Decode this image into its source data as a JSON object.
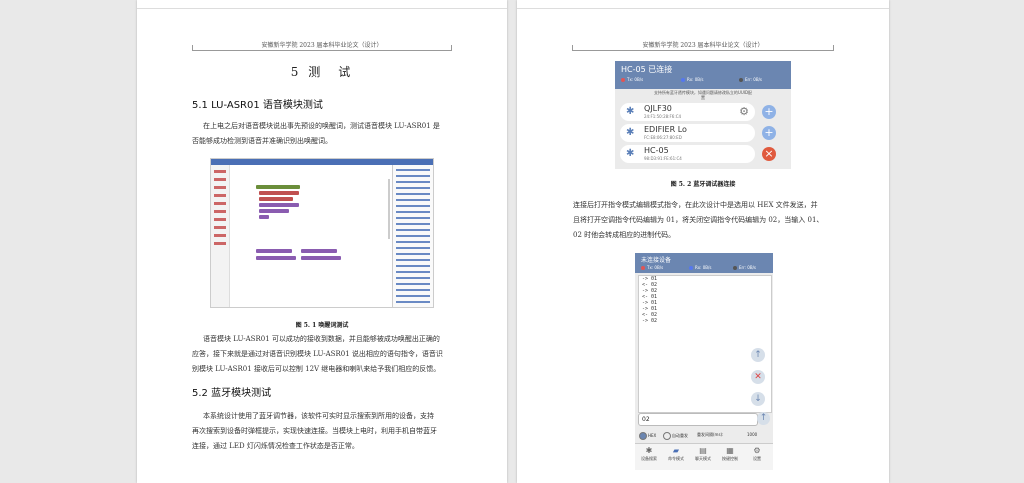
{
  "header_text": "安徽新华学院 2023 届本科毕业论文（设计）",
  "left": {
    "chapter_title": "5 测　试",
    "sec1_title": "5.1 LU-ASR01 语音模块测试",
    "para1_line1": "在上电之后对语音模块说出事先预设的唤醒词，测试语音模块 LU-ASR01 是",
    "para1_line2": "否能够成功检测到语音并准确识别出唤醒词。",
    "fig1_caption": "图 5. 1 唤醒词测试",
    "para2_line1": "语音模块 LU-ASR01 可以成功的接收到数据，并且能够被成功唤醒出正确的",
    "para2_line2": "应答，接下来就是通过对语音识别模块 LU-ASR01 说出相应的语句指令，语音识",
    "para2_line3": "别模块 LU-ASR01 接收后可以控制 12V 继电器和喇叭来给予我们相应的反馈。",
    "sec2_title": "5.2 蓝牙模块测试",
    "para3_line1": "本系统设计使用了蓝牙调节器，该软件可实时显示搜索到所用的设备，支持",
    "para3_line2": "再次搜索到设备时弹框提示，实现快速连接。当模块上电时，利用手机自带蓝牙",
    "para3_line3": "连接，通过 LED 灯闪烁情况检查工作状态是否正常。"
  },
  "right": {
    "phone1": {
      "title": "HC-05 已连接",
      "tx": "Tx: 0B/s",
      "rx": "Rx: 0B/s",
      "err": "Err: 0B/s",
      "hint_line1": "支持所有蓝牙透传模块，如遇问题请修改私立的UUID配",
      "hint_line2": "置",
      "devices": [
        {
          "name": "QJLF30",
          "mac": "24:F1:50:28:F6:C4"
        },
        {
          "name": "EDIFIER Lo",
          "mac": "FC:E8:06:27:80:ED"
        },
        {
          "name": "HC-05",
          "mac": "98:D3:91:FE:61:C4"
        }
      ]
    },
    "fig2_caption": "图 5. 2 蓝牙调试器连接",
    "para1_line1": "连接后打开指令模式编辑模式指令，在此次设计中是选用以 HEX 文件发送，并",
    "para1_line2": "且将打开空调指令代码编辑为 01，将关闭空调指令代码编辑为 02，当输入 01、",
    "para1_line3": "02 时他会转成相应的进制代码。",
    "phone2": {
      "title": "未连接设备",
      "tx": "Tx: 0B/s",
      "rx": "Rx: 0B/s",
      "err": "Err: 0B/s",
      "log": [
        "-> 01",
        "<- 02",
        "-> 02",
        "<- 01",
        "-> 01",
        "-> 01",
        "<- 02",
        "-> 02"
      ],
      "input_value": "02",
      "opt_hex": "HEX",
      "opt_auto": "自动重发",
      "opt_interval": "重发间隔(ms):",
      "opt_interval_value": "1000",
      "nav": [
        "设备搜索",
        "命令模式",
        "聊天模式",
        "按键控制",
        "设置"
      ]
    }
  },
  "colors": {
    "accent": "#6b86b1",
    "tx": "#e05555",
    "rx": "#5577ee",
    "err": "#555555",
    "add": "#8fb2e6",
    "del": "#e05a3e"
  }
}
